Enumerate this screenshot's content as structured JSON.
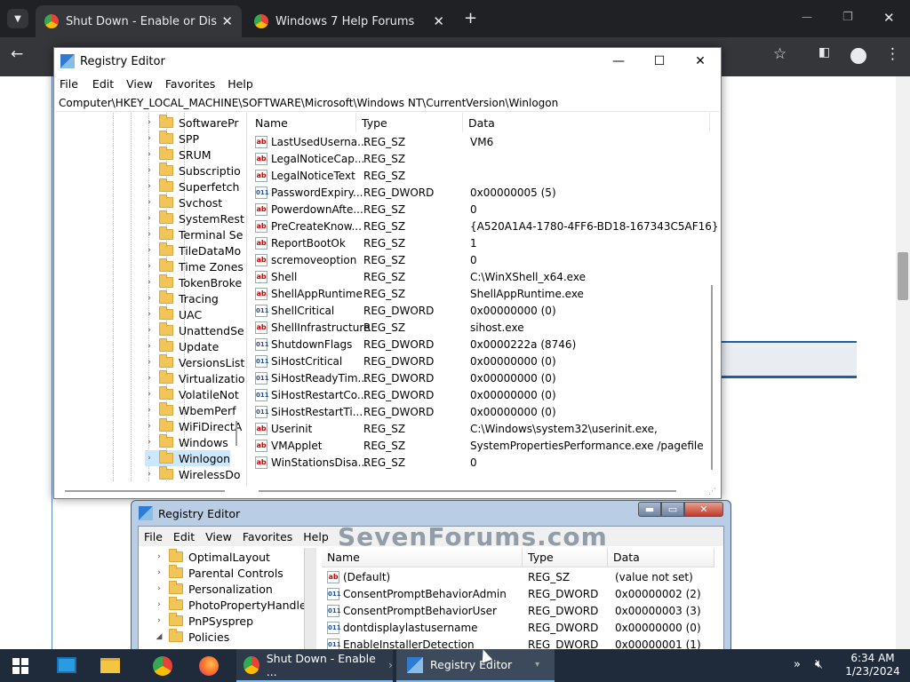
{
  "chrome": {
    "tabs": [
      {
        "title": "Shut Down - Enable or Disable ",
        "close": "✕"
      },
      {
        "title": "Windows 7 Help Forums",
        "close": "✕"
      }
    ],
    "new_tab": "+",
    "window_controls": [
      "—",
      "❐",
      "✕"
    ]
  },
  "regedit10": {
    "title": "Registry Editor",
    "controls": [
      "—",
      "☐",
      "✕"
    ],
    "menu": [
      "File",
      "Edit",
      "View",
      "Favorites",
      "Help"
    ],
    "address": "Computer\\HKEY_LOCAL_MACHINE\\SOFTWARE\\Microsoft\\Windows NT\\CurrentVersion\\Winlogon",
    "tree": [
      "SoftwarePr",
      "SPP",
      "SRUM",
      "Subscriptio",
      "Superfetch",
      "Svchost",
      "SystemRest",
      "Terminal Se",
      "TileDataMo",
      "Time Zones",
      "TokenBroke",
      "Tracing",
      "UAC",
      "UnattendSe",
      "Update",
      "VersionsList",
      "Virtualizatio",
      "VolatileNot",
      "WbemPerf",
      "WiFiDirectA",
      "Windows",
      "Winlogon",
      "WirelessDo"
    ],
    "selected": "Winlogon",
    "columns": [
      "Name",
      "Type",
      "Data"
    ],
    "rows": [
      {
        "name": "LastUsedUserna...",
        "type": "REG_SZ",
        "data": "VM6",
        "kind": "sz"
      },
      {
        "name": "LegalNoticeCap...",
        "type": "REG_SZ",
        "data": "",
        "kind": "sz"
      },
      {
        "name": "LegalNoticeText",
        "type": "REG_SZ",
        "data": "",
        "kind": "sz"
      },
      {
        "name": "PasswordExpiry...",
        "type": "REG_DWORD",
        "data": "0x00000005 (5)",
        "kind": "dword"
      },
      {
        "name": "PowerdownAfte...",
        "type": "REG_SZ",
        "data": "0",
        "kind": "sz"
      },
      {
        "name": "PreCreateKnow...",
        "type": "REG_SZ",
        "data": "{A520A1A4-1780-4FF6-BD18-167343C5AF16}",
        "kind": "sz"
      },
      {
        "name": "ReportBootOk",
        "type": "REG_SZ",
        "data": "1",
        "kind": "sz"
      },
      {
        "name": "scremoveoption",
        "type": "REG_SZ",
        "data": "0",
        "kind": "sz"
      },
      {
        "name": "Shell",
        "type": "REG_SZ",
        "data": "C:\\WinXShell_x64.exe",
        "kind": "sz"
      },
      {
        "name": "ShellAppRuntime",
        "type": "REG_SZ",
        "data": "ShellAppRuntime.exe",
        "kind": "sz"
      },
      {
        "name": "ShellCritical",
        "type": "REG_DWORD",
        "data": "0x00000000 (0)",
        "kind": "dword"
      },
      {
        "name": "ShellInfrastructure",
        "type": "REG_SZ",
        "data": "sihost.exe",
        "kind": "sz"
      },
      {
        "name": "ShutdownFlags",
        "type": "REG_DWORD",
        "data": "0x0000222a (8746)",
        "kind": "dword"
      },
      {
        "name": "SiHostCritical",
        "type": "REG_DWORD",
        "data": "0x00000000 (0)",
        "kind": "dword"
      },
      {
        "name": "SiHostReadyTim...",
        "type": "REG_DWORD",
        "data": "0x00000000 (0)",
        "kind": "dword"
      },
      {
        "name": "SiHostRestartCo...",
        "type": "REG_DWORD",
        "data": "0x00000000 (0)",
        "kind": "dword"
      },
      {
        "name": "SiHostRestartTi...",
        "type": "REG_DWORD",
        "data": "0x00000000 (0)",
        "kind": "dword"
      },
      {
        "name": "Userinit",
        "type": "REG_SZ",
        "data": "C:\\Windows\\system32\\userinit.exe,",
        "kind": "sz"
      },
      {
        "name": "VMApplet",
        "type": "REG_SZ",
        "data": "SystemPropertiesPerformance.exe /pagefile",
        "kind": "sz"
      },
      {
        "name": "WinStationsDisa...",
        "type": "REG_SZ",
        "data": "0",
        "kind": "sz"
      }
    ]
  },
  "regedit7": {
    "title": "Registry Editor",
    "controls": [
      "▬",
      "▭",
      "✕"
    ],
    "menu": [
      "File",
      "Edit",
      "View",
      "Favorites",
      "Help"
    ],
    "tree": [
      "OptimalLayout",
      "Parental Controls",
      "Personalization",
      "PhotoPropertyHandler",
      "PnPSysprep",
      "Policies"
    ],
    "columns": [
      "Name",
      "Type",
      "Data"
    ],
    "rows": [
      {
        "name": "(Default)",
        "type": "REG_SZ",
        "data": "(value not set)",
        "kind": "sz"
      },
      {
        "name": "ConsentPromptBehaviorAdmin",
        "type": "REG_DWORD",
        "data": "0x00000002 (2)",
        "kind": "dword"
      },
      {
        "name": "ConsentPromptBehaviorUser",
        "type": "REG_DWORD",
        "data": "0x00000003 (3)",
        "kind": "dword"
      },
      {
        "name": "dontdisplaylastusername",
        "type": "REG_DWORD",
        "data": "0x00000000 (0)",
        "kind": "dword"
      },
      {
        "name": "EnableInstallerDetection",
        "type": "REG_DWORD",
        "data": "0x00000001 (1)",
        "kind": "dword"
      }
    ]
  },
  "watermark": "SevenForums.com",
  "taskbar": {
    "apps": [
      {
        "label": "Shut Down - Enable ...",
        "icon": "chrome-icon"
      },
      {
        "label": "Registry Editor",
        "icon": "regedit-icon"
      }
    ],
    "time": "6:34 AM",
    "date": "1/23/2024"
  },
  "icons": {
    "sz": "ab",
    "dword": "011",
    "tree_chevron": "›",
    "tree_expanded": "◢"
  }
}
